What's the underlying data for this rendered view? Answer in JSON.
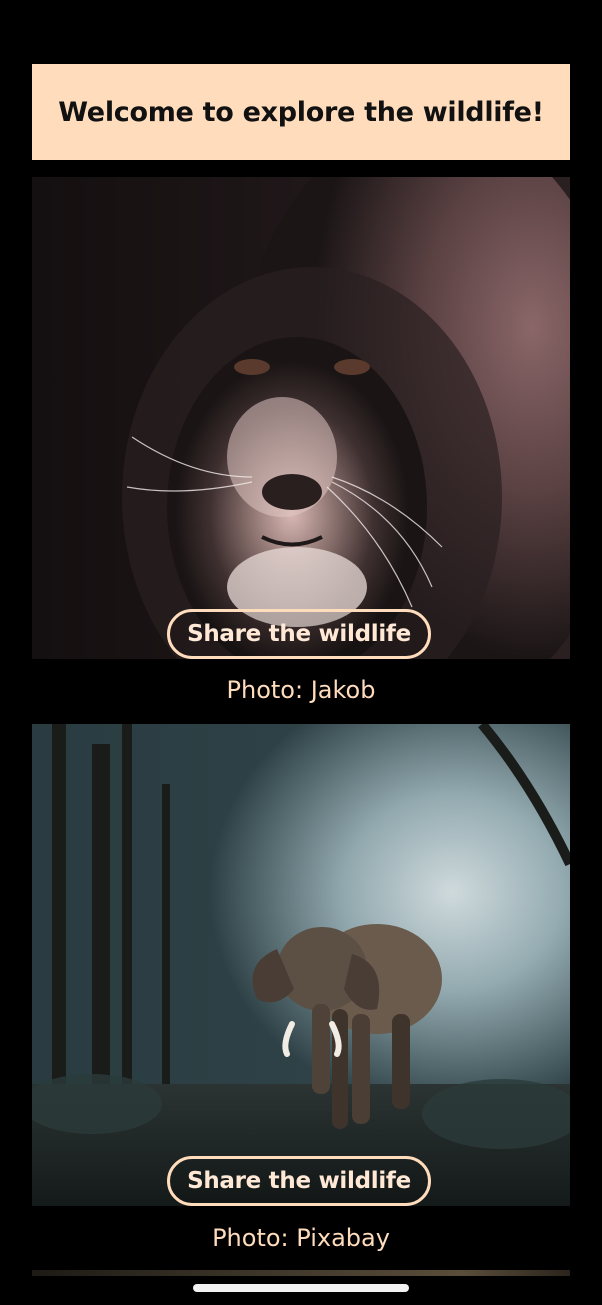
{
  "banner": {
    "title": "Welcome to explore the wildlife!"
  },
  "cards": [
    {
      "image_subject": "lion",
      "share_label": "Share the wildlife",
      "caption": "Photo: Jakob"
    },
    {
      "image_subject": "elephant",
      "share_label": "Share the wildlife",
      "caption": "Photo: Pixabay"
    }
  ],
  "colors": {
    "accent": "#ffdcbc",
    "background": "#000000"
  }
}
